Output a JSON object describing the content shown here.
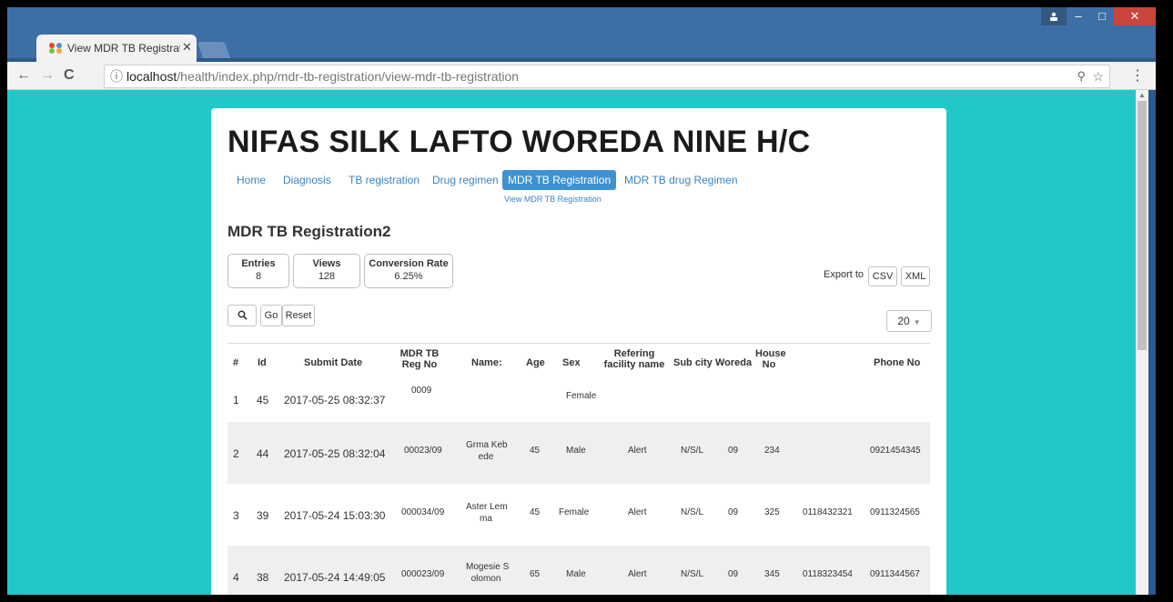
{
  "browser": {
    "tab_title": "View MDR TB Registratio",
    "tab_close": "✕",
    "url_host": "localhost",
    "url_path": "/health/index.php/mdr-tb-registration/view-mdr-tb-registration",
    "win_min": "–",
    "win_max": "□",
    "win_close": "✕"
  },
  "site": {
    "title": "NIFAS SILK LAFTO WOREDA NINE H/C",
    "nav": [
      "Home",
      "Diagnosis",
      "TB registration",
      "Drug regimen",
      "MDR TB Registration",
      "MDR TB drug Regimen"
    ],
    "active_nav": "MDR TB Registration",
    "subnav": "View MDR TB Registration"
  },
  "page": {
    "heading": "MDR TB Registration2",
    "stats": [
      {
        "label": "Entries",
        "value": "8"
      },
      {
        "label": "Views",
        "value": "128"
      },
      {
        "label": "Conversion Rate",
        "value": "6.25%"
      }
    ],
    "export_label": "Export to",
    "export_csv": "CSV",
    "export_xml": "XML",
    "go_label": "Go",
    "reset_label": "Reset",
    "page_size": "20"
  },
  "table": {
    "headers": [
      "#",
      "Id",
      "Submit Date",
      "MDR TB Reg No",
      "Name:",
      "Age",
      "Sex",
      "Refering facility name",
      "Sub city",
      "Woreda",
      "House No",
      "",
      "Phone No"
    ],
    "rows": [
      {
        "n": "1",
        "id": "45",
        "date": "2017-05-25 08:32:37",
        "reg": "0009",
        "name1": "",
        "name2": "",
        "age": "",
        "sex": "Female",
        "facility": "",
        "subcity": "",
        "woreda": "",
        "house": "",
        "phone1": "",
        "phone2": ""
      },
      {
        "n": "2",
        "id": "44",
        "date": "2017-05-25 08:32:04",
        "reg": "00023/09",
        "name1": "Grma  Keb",
        "name2": "ede",
        "age": "45",
        "sex": "Male",
        "facility": "Alert",
        "subcity": "N/S/L",
        "woreda": "09",
        "house": "234",
        "phone1": "",
        "phone2": "0921454345"
      },
      {
        "n": "3",
        "id": "39",
        "date": "2017-05-24 15:03:30",
        "reg": "000034/09",
        "name1": "Aster Lem",
        "name2": "ma",
        "age": "45",
        "sex": "Female",
        "facility": "Alert",
        "subcity": "N/S/L",
        "woreda": "09",
        "house": "325",
        "phone1": "0118432321",
        "phone2": "0911324565"
      },
      {
        "n": "4",
        "id": "38",
        "date": "2017-05-24 14:49:05",
        "reg": "000023/09",
        "name1": "Mogesie S",
        "name2": "olomon",
        "age": "65",
        "sex": "Male",
        "facility": "Alert",
        "subcity": "N/S/L",
        "woreda": "09",
        "house": "345",
        "phone1": "0118323454",
        "phone2": "0911344567"
      }
    ]
  }
}
